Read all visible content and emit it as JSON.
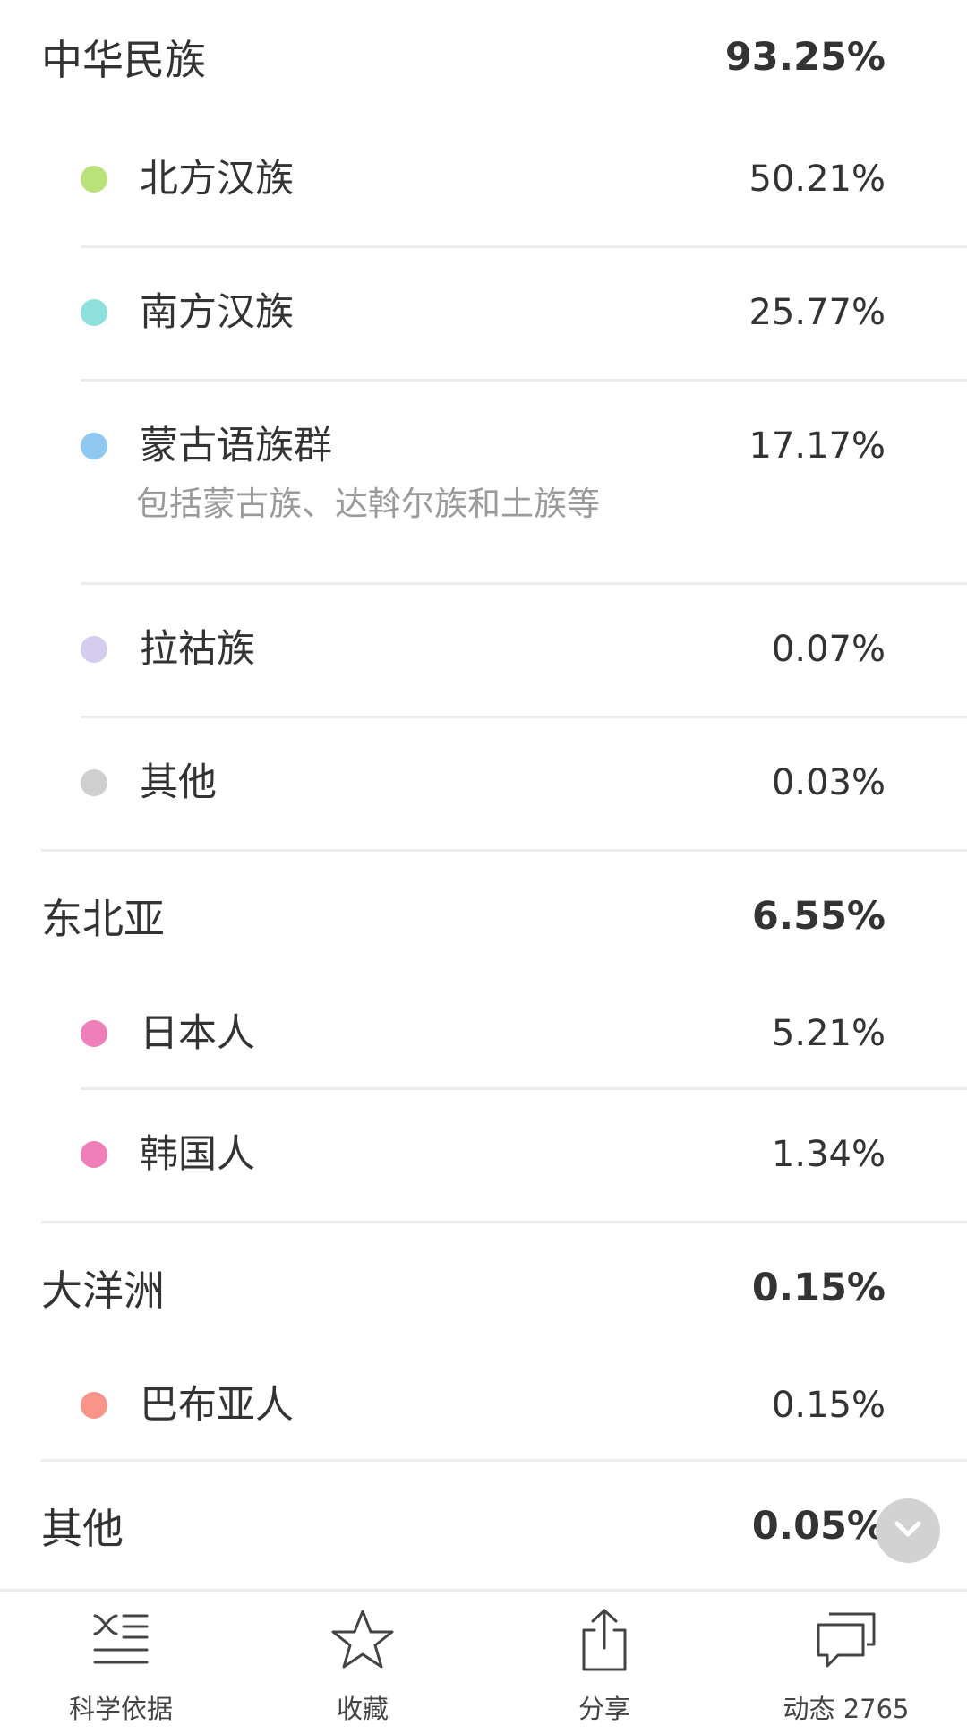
{
  "groups": [
    {
      "name": "中华民族",
      "pct": "93.25%",
      "items": [
        {
          "name": "北方汉族",
          "pct": "50.21%",
          "color": "#b9e37a"
        },
        {
          "name": "南方汉族",
          "pct": "25.77%",
          "color": "#8fe0dc"
        },
        {
          "name": "蒙古语族群",
          "pct": "17.17%",
          "color": "#8fc9f2",
          "note": "包括蒙古族、达斡尔族和土族等"
        },
        {
          "name": "拉祜族",
          "pct": "0.07%",
          "color": "#d6ccf0"
        },
        {
          "name": "其他",
          "pct": "0.03%",
          "color": "#cfcfcf"
        }
      ]
    },
    {
      "name": "东北亚",
      "pct": "6.55%",
      "items": [
        {
          "name": "日本人",
          "pct": "5.21%",
          "color": "#ef7fb8"
        },
        {
          "name": "韩国人",
          "pct": "1.34%",
          "color": "#ef7fb8"
        }
      ]
    },
    {
      "name": "大洋洲",
      "pct": "0.15%",
      "items": [
        {
          "name": "巴布亚人",
          "pct": "0.15%",
          "color": "#f7958b"
        }
      ]
    },
    {
      "name": "其他",
      "pct": "0.05%",
      "items": []
    }
  ],
  "scroll_button": {
    "icon": "chevron-down-icon"
  },
  "tabbar": {
    "science": {
      "label": "科学依据",
      "icon": "science-basis-icon"
    },
    "favorite": {
      "label": "收藏",
      "icon": "star-icon"
    },
    "share": {
      "label": "分享",
      "icon": "share-icon"
    },
    "activity": {
      "label": "动态 2765",
      "icon": "chat-bubbles-icon"
    }
  }
}
